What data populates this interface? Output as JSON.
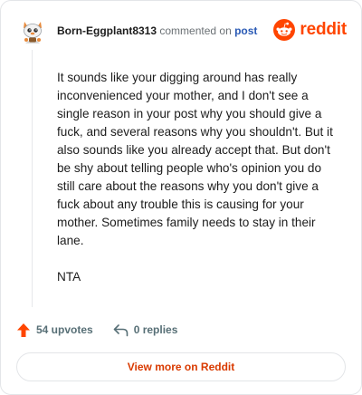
{
  "comment": {
    "username": "Born-Eggplant8313",
    "commented_text": "commented on",
    "post_link": "post",
    "paragraphs": [
      "It sounds like your digging around has really inconvenienced your mother, and I don't see a single reason in your post why you should give a fuck, and several reasons why you shouldn't. But it also sounds like you already accept that. But don't be shy about telling people who's opinion you do still care about the reasons why you don't give a fuck about any trouble this is causing for your mother. Sometimes family needs to stay in their lane.",
      "NTA"
    ]
  },
  "brand": {
    "wordmark": "reddit",
    "color": "#ff4500"
  },
  "actions": {
    "upvotes_label": "54 upvotes",
    "replies_label": "0 replies"
  },
  "footer": {
    "view_more_label": "View more on Reddit"
  },
  "colors": {
    "upvote": "#ff4500",
    "link": "#2a5ab5",
    "view_more": "#d93a00"
  },
  "icons": {
    "avatar": "snoo-avatar-icon",
    "logo": "reddit-snoo-icon",
    "upvote": "upvote-arrow-icon",
    "reply": "reply-arrow-icon"
  }
}
